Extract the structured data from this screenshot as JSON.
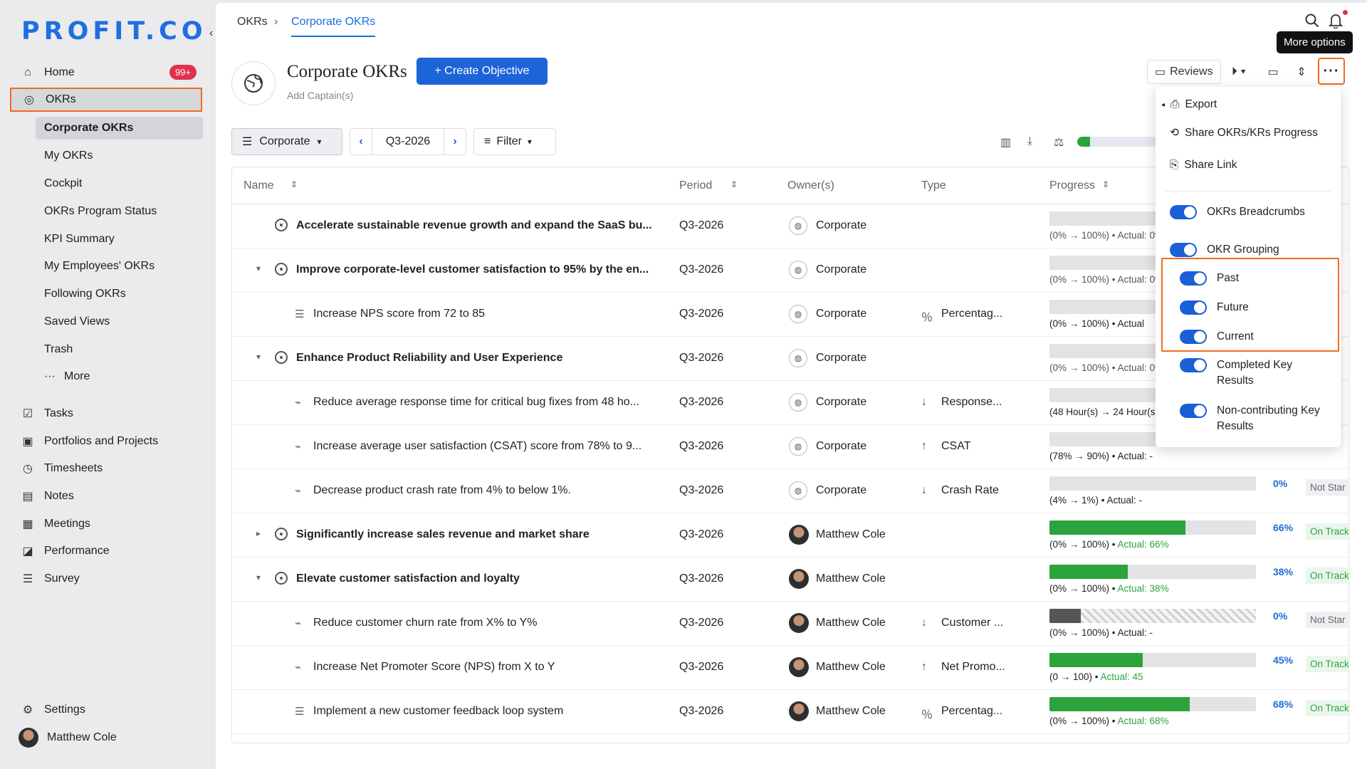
{
  "app": {
    "logo": "PROFIT.CO"
  },
  "sidebar": {
    "home": "Home",
    "home_badge": "99+",
    "okrs": "OKRs",
    "okr_sub": [
      "Corporate OKRs",
      "My OKRs",
      "Cockpit",
      "OKRs Program Status",
      "KPI Summary",
      "My Employees' OKRs",
      "Following OKRs",
      "Saved Views",
      "Trash",
      "More"
    ],
    "tasks": "Tasks",
    "portfolios": "Portfolios and Projects",
    "timesheets": "Timesheets",
    "notes": "Notes",
    "meetings": "Meetings",
    "performance": "Performance",
    "survey": "Survey",
    "settings": "Settings",
    "user": "Matthew Cole"
  },
  "breadcrumb": {
    "root": "OKRs",
    "sep": "›",
    "current": "Corporate OKRs"
  },
  "header": {
    "title": "Corporate OKRs",
    "add_captain": "Add Captain(s)",
    "create_btn": "+ Create Objective",
    "reviews": "Reviews",
    "tooltip": "More options",
    "more": "···"
  },
  "toolbar": {
    "view": "Corporate",
    "period": "Q3-2026",
    "filter": "Filter"
  },
  "table": {
    "headers": {
      "name": "Name",
      "period": "Period",
      "owner": "Owner(s)",
      "type": "Type",
      "progress": "Progress"
    },
    "rows": [
      {
        "name": "Accelerate sustainable revenue growth and expand the SaaS bu...",
        "period": "Q3-2026",
        "owner": "Corporate",
        "type": "",
        "range": "(0% → 100%)",
        "actual": "Actual: 0%",
        "pct": "",
        "status": ""
      },
      {
        "name": "Improve corporate-level customer satisfaction to 95% by the en...",
        "period": "Q3-2026",
        "owner": "Corporate",
        "type": "",
        "range": "(0% → 100%)",
        "actual": "Actual: 0%",
        "pct": "",
        "status": ""
      },
      {
        "name": "Increase NPS score from 72 to 85",
        "period": "Q3-2026",
        "owner": "Corporate",
        "type": "Percentag...",
        "range": "(0% → 100%)",
        "actual": "Actual",
        "pct": "",
        "status": ""
      },
      {
        "name": "Enhance Product Reliability and User Experience",
        "period": "Q3-2026",
        "owner": "Corporate",
        "type": "",
        "range": "(0% → 100%)",
        "actual": "Actual: 0%",
        "pct": "",
        "status": ""
      },
      {
        "name": "Reduce average response time for critical bug fixes from 48 ho...",
        "period": "Q3-2026",
        "owner": "Corporate",
        "type": "Response...",
        "range": "(48 Hour(s) → 24 Hour(s))",
        "actual": "",
        "pct": "",
        "status": ""
      },
      {
        "name": "Increase average user satisfaction (CSAT) score from 78% to 9...",
        "period": "Q3-2026",
        "owner": "Corporate",
        "type": "CSAT",
        "range": "(78% → 90%)",
        "actual": "Actual: -",
        "pct": "",
        "status": ""
      },
      {
        "name": "Decrease product crash rate from 4% to below 1%.",
        "period": "Q3-2026",
        "owner": "Corporate",
        "type": "Crash Rate",
        "range": "(4% → 1%)",
        "actual": "Actual: -",
        "pct": "0%",
        "status": "Not Star"
      },
      {
        "name": "Significantly increase sales revenue and market share",
        "period": "Q3-2026",
        "owner": "Matthew Cole",
        "type": "",
        "range": "(0% → 100%)",
        "actual": "Actual: 66%",
        "pct": "66%",
        "status": "On Track",
        "progress": 0.66
      },
      {
        "name": "Elevate customer satisfaction and loyalty",
        "period": "Q3-2026",
        "owner": "Matthew Cole",
        "type": "",
        "range": "(0% → 100%)",
        "actual": "Actual: 38%",
        "pct": "38%",
        "status": "On Track",
        "progress": 0.38
      },
      {
        "name": "Reduce customer churn rate from X% to Y%",
        "period": "Q3-2026",
        "owner": "Matthew Cole",
        "type": "Customer ...",
        "range": "(0% → 100%)",
        "actual": "Actual: -",
        "pct": "0%",
        "status": "Not Star"
      },
      {
        "name": "Increase Net Promoter Score (NPS) from X to Y",
        "period": "Q3-2026",
        "owner": "Matthew Cole",
        "type": "Net Promo...",
        "range": "(0 → 100)",
        "actual": "Actual: 45",
        "pct": "45%",
        "status": "On Track",
        "progress": 0.45
      },
      {
        "name": "Implement a new customer feedback loop system",
        "period": "Q3-2026",
        "owner": "Matthew Cole",
        "type": "Percentag...",
        "range": "(0% → 100%)",
        "actual": "Actual: 68%",
        "pct": "68%",
        "status": "On Track",
        "progress": 0.68
      }
    ]
  },
  "menu": {
    "export": "Export",
    "share_progress": "Share OKRs/KRs Progress",
    "share_link": "Share Link",
    "breadcrumbs": "OKRs Breadcrumbs",
    "grouping": "OKR Grouping",
    "past": "Past",
    "future": "Future",
    "current": "Current",
    "completed": "Completed Key Results",
    "noncontributing": "Non-contributing Key Results"
  },
  "colors": {
    "accent": "#1c64d8",
    "highlight": "#f06a1e",
    "success": "#2da33c"
  }
}
